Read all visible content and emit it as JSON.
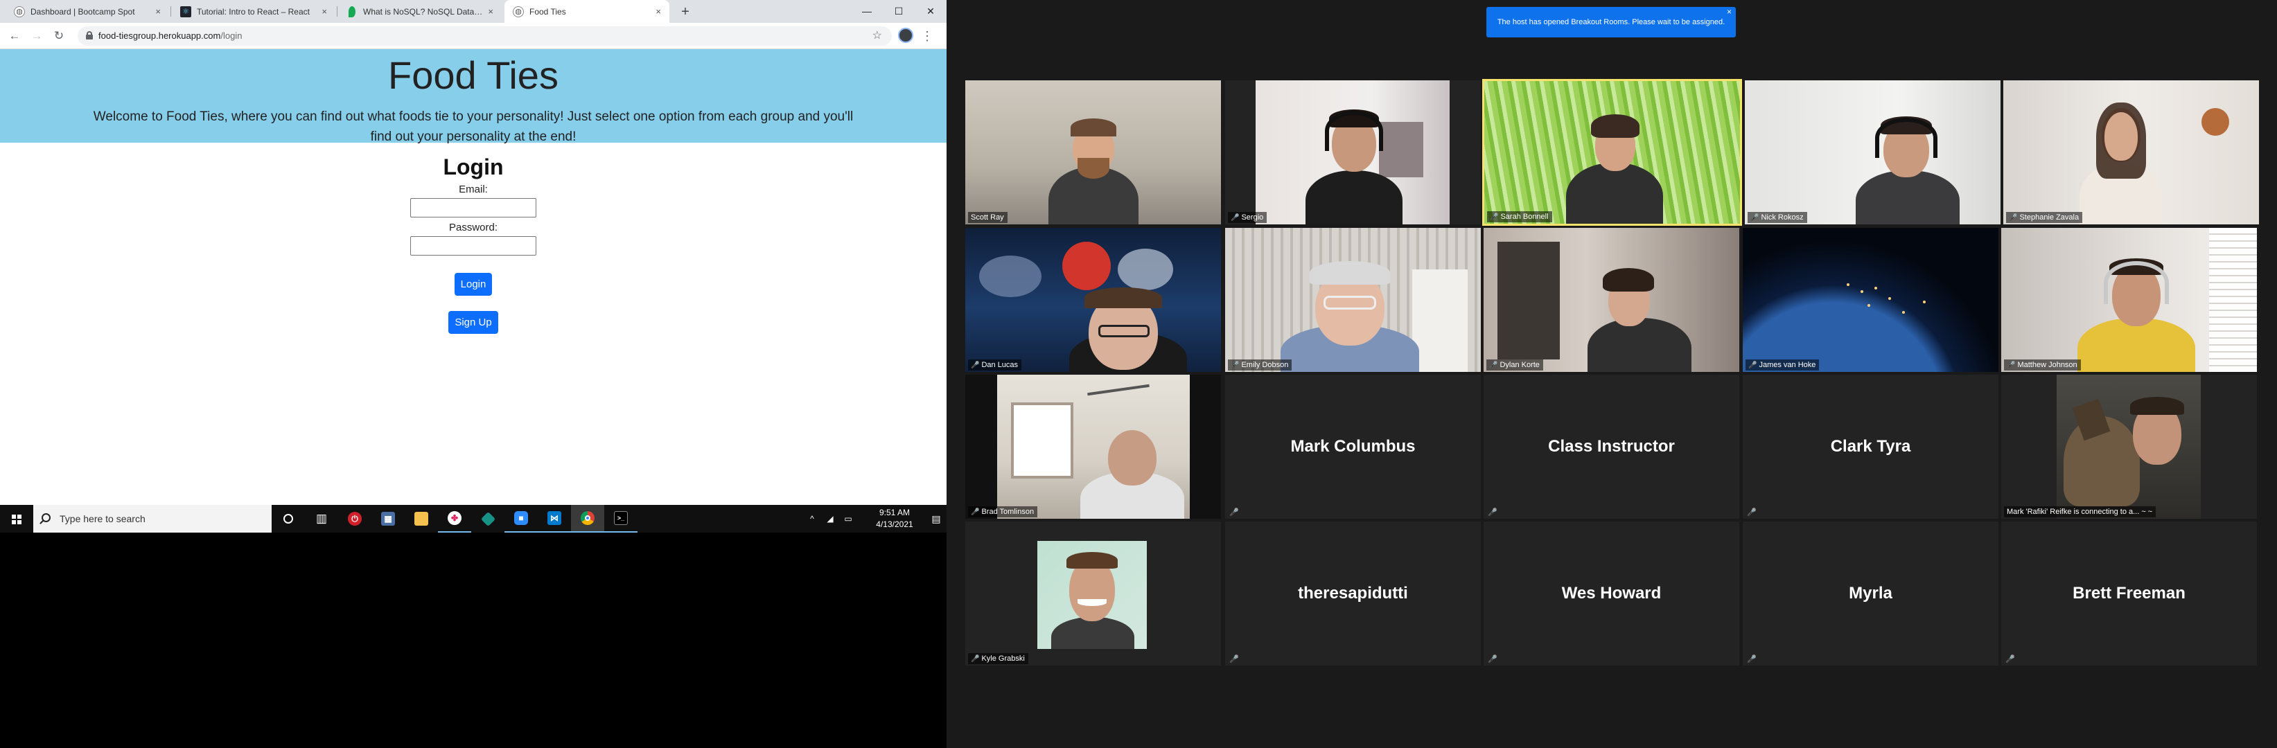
{
  "browser": {
    "tabs": [
      {
        "title": "Dashboard | Bootcamp Spot",
        "favicon": "globe-icon",
        "active": false
      },
      {
        "title": "Tutorial: Intro to React – React",
        "favicon": "react-icon",
        "active": false
      },
      {
        "title": "What is NoSQL? NoSQL Databases",
        "favicon": "mongodb-leaf-icon",
        "active": false
      },
      {
        "title": "Food Ties",
        "favicon": "globe-icon",
        "active": true
      }
    ],
    "close_glyph": "×",
    "new_tab_glyph": "+",
    "window_controls": {
      "minimize": "—",
      "maximize": "☐",
      "close": "✕"
    },
    "address": {
      "host": "food-tiesgroup.herokuapp.com",
      "path": "/login"
    }
  },
  "page": {
    "title": "Food Ties",
    "intro": "Welcome to Food Ties, where you can find out what foods tie to your personality! Just select one option from each group and you'll find out your personality at the end!",
    "login_heading": "Login",
    "email_label": "Email:",
    "password_label": "Password:",
    "login_button": "Login",
    "signup_button": "Sign Up"
  },
  "taskbar": {
    "search_placeholder": "Type here to search",
    "pinned": [
      "cortana-icon",
      "task-view-icon",
      "red-app-icon",
      "calculator-icon",
      "file-explorer-icon",
      "slack-icon",
      "gitkraken-icon",
      "zoom-icon",
      "vscode-icon",
      "chrome-icon",
      "terminal-icon"
    ],
    "tray_chevron": "^",
    "time": "9:51 AM",
    "date": "4/13/2021"
  },
  "zoom": {
    "banner_text": "The host has opened Breakout Rooms. Please wait to be assigned.",
    "banner_close": "×",
    "mute_glyph": "🎤",
    "participants": [
      {
        "name": "Scott Ray",
        "video": true,
        "muted": false,
        "speaker": false
      },
      {
        "name": "Sergio",
        "video": true,
        "muted": true,
        "speaker": false
      },
      {
        "name": "Sarah Bonnell",
        "video": true,
        "muted": true,
        "speaker": true
      },
      {
        "name": "Nick Rokosz",
        "video": true,
        "muted": true,
        "speaker": false
      },
      {
        "name": "Stephanie Zavala",
        "video": true,
        "muted": true,
        "speaker": false
      },
      {
        "name": "Dan Lucas",
        "video": true,
        "muted": true,
        "speaker": false
      },
      {
        "name": "Emily Dobson",
        "video": true,
        "muted": true,
        "speaker": false
      },
      {
        "name": "Dylan Korte",
        "video": true,
        "muted": true,
        "speaker": false
      },
      {
        "name": "James van Hoke",
        "video": true,
        "muted": true,
        "speaker": false
      },
      {
        "name": "Matthew Johnson",
        "video": true,
        "muted": true,
        "speaker": false
      },
      {
        "name": "Brad Tomlinson",
        "video": true,
        "muted": true,
        "speaker": false
      },
      {
        "name": "Mark Columbus",
        "video": false,
        "muted": true,
        "speaker": false
      },
      {
        "name": "Class Instructor",
        "video": false,
        "muted": true,
        "speaker": false
      },
      {
        "name": "Clark Tyra",
        "video": false,
        "muted": true,
        "speaker": false
      },
      {
        "name": "Mark 'Rafiki' Reifke is connecting to a... ~ ~",
        "video": true,
        "muted": false,
        "speaker": false
      },
      {
        "name": "Kyle Grabski",
        "video": true,
        "muted": true,
        "speaker": false
      },
      {
        "name": "theresapidutti",
        "video": false,
        "muted": true,
        "speaker": false
      },
      {
        "name": "Wes Howard",
        "video": false,
        "muted": true,
        "speaker": false
      },
      {
        "name": "Myrla",
        "video": false,
        "muted": true,
        "speaker": false
      },
      {
        "name": "Brett Freeman",
        "video": false,
        "muted": true,
        "speaker": false
      }
    ]
  }
}
